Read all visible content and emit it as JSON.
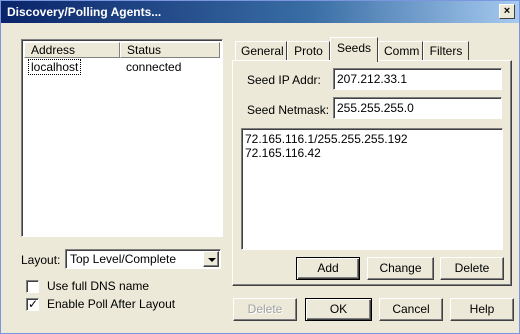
{
  "window": {
    "title": "Discovery/Polling Agents...",
    "close_glyph": "×"
  },
  "agents": {
    "columns": [
      "Address",
      "Status"
    ],
    "rows": [
      {
        "address": "localhost",
        "status": "connected"
      }
    ]
  },
  "layout": {
    "label": "Layout:",
    "value": "Top Level/Complete"
  },
  "options": {
    "full_dns": {
      "label": "Use full DNS name",
      "checked": false
    },
    "enable_poll": {
      "label": "Enable Poll After Layout",
      "checked": true
    }
  },
  "tabs": [
    {
      "label": "General",
      "active": false
    },
    {
      "label": "Proto",
      "active": false
    },
    {
      "label": "Seeds",
      "active": true
    },
    {
      "label": "Comm",
      "active": false
    },
    {
      "label": "Filters",
      "active": false
    }
  ],
  "seeds": {
    "ip_label": "Seed IP Addr:",
    "ip_value": "207.212.33.1",
    "netmask_label": "Seed Netmask:",
    "netmask_value": "255.255.255.0",
    "list": [
      "72.165.116.1/255.255.255.192",
      "72.165.116.42"
    ],
    "buttons": {
      "add": "Add",
      "change": "Change",
      "delete": "Delete"
    }
  },
  "footer": {
    "delete": "Delete",
    "ok": "OK",
    "cancel": "Cancel",
    "help": "Help"
  }
}
